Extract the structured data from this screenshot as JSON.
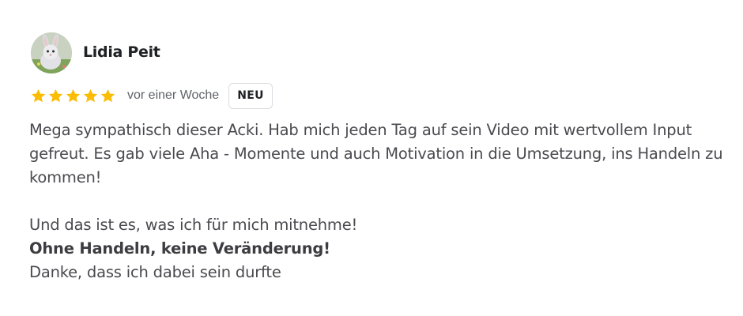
{
  "review": {
    "author": "Lidia Peit",
    "avatar_icon": "bunny-avatar",
    "rating": 5,
    "rating_max": 5,
    "star_color": "#fbbc04",
    "date": "vor einer Woche",
    "badge": "NEU",
    "paragraph_1": "Mega sympathisch dieser Acki. Hab mich jeden Tag auf sein Video mit wertvollem Input gefreut. Es gab viele Aha - Momente und auch Motivation in die Umsetzung, ins Handeln zu kommen!",
    "line_2": "Und das ist es, was ich für mich mitnehme!",
    "line_3": "Ohne Handeln, keine Veränderung!",
    "line_4": "Danke, dass ich dabei sein durfte"
  }
}
